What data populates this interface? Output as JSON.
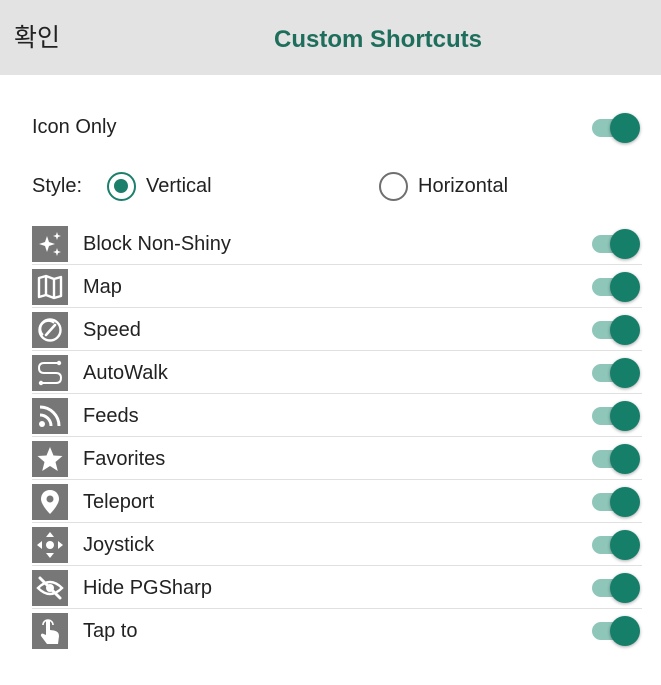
{
  "header": {
    "confirm_label": "확인",
    "title": "Custom Shortcuts"
  },
  "icon_only": {
    "label": "Icon Only",
    "enabled": true
  },
  "style": {
    "label": "Style:",
    "options": [
      {
        "label": "Vertical",
        "selected": true
      },
      {
        "label": "Horizontal",
        "selected": false
      }
    ]
  },
  "shortcuts": [
    {
      "label": "Block Non-Shiny",
      "icon": "sparkle-icon",
      "enabled": true
    },
    {
      "label": "Map",
      "icon": "map-icon",
      "enabled": true
    },
    {
      "label": "Speed",
      "icon": "speedometer-icon",
      "enabled": true
    },
    {
      "label": "AutoWalk",
      "icon": "route-icon",
      "enabled": true
    },
    {
      "label": "Feeds",
      "icon": "rss-icon",
      "enabled": true
    },
    {
      "label": "Favorites",
      "icon": "star-icon",
      "enabled": true
    },
    {
      "label": "Teleport",
      "icon": "location-pin-icon",
      "enabled": true
    },
    {
      "label": "Joystick",
      "icon": "joystick-icon",
      "enabled": true
    },
    {
      "label": "Hide PGSharp",
      "icon": "eye-off-icon",
      "enabled": true
    },
    {
      "label": "Tap to",
      "icon": "tap-hand-icon",
      "enabled": true
    }
  ],
  "colors": {
    "accent": "#1c7f6c",
    "title": "#1e6e5c",
    "header_bg": "#e3e3e3",
    "icon_bg": "#777777"
  }
}
